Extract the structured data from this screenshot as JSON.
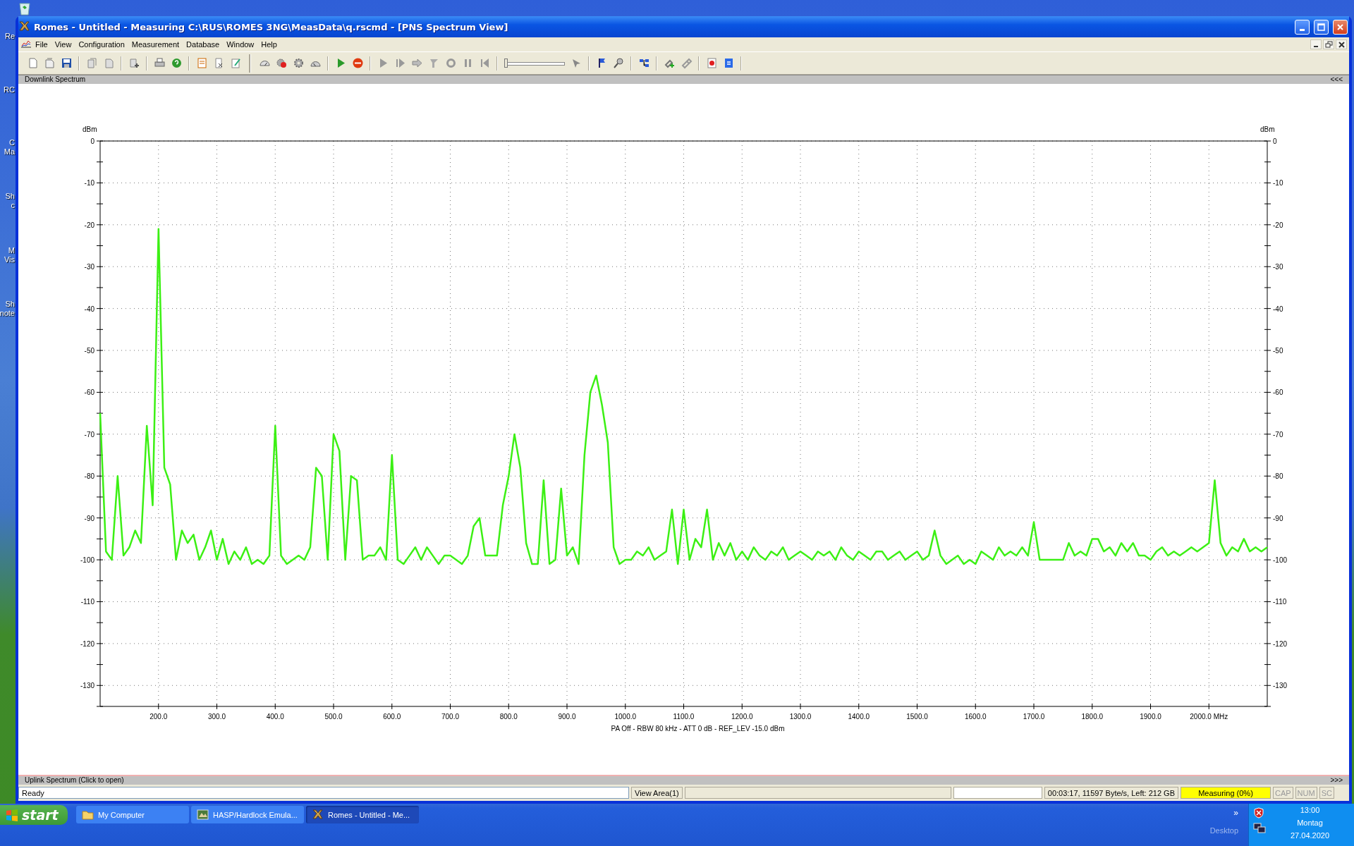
{
  "desktop": {
    "icons": [
      {
        "lines": [
          "Re"
        ]
      },
      {
        "lines": [
          "RC"
        ]
      },
      {
        "lines": [
          "C",
          "Ma"
        ]
      },
      {
        "lines": [
          "Sh",
          "c"
        ]
      },
      {
        "lines": [
          "M",
          "Vis"
        ]
      },
      {
        "lines": [
          "Sh",
          "note"
        ]
      }
    ]
  },
  "window": {
    "title": "Romes - Untitled - Measuring C:\\RUS\\ROMES 3NG\\MeasData\\q.rscmd - [PNS Spectrum View]"
  },
  "menu": [
    "File",
    "View",
    "Configuration",
    "Measurement",
    "Database",
    "Window",
    "Help"
  ],
  "toolbar": {
    "slider": {
      "level": 0
    }
  },
  "downlink": {
    "title": "Downlink Spectrum",
    "toggle": "<<<"
  },
  "chart": {
    "left_unit": "dBm",
    "right_unit": "dBm",
    "right_axis_labels": [
      "0",
      "-10",
      "-20",
      "-30",
      "-40",
      "-50",
      "-60",
      "-70",
      "-80",
      "-90",
      "-100",
      "-110",
      "-120",
      "-130"
    ],
    "caption": "PA Off - RBW 80 kHz - ATT 0 dB - REF_LEV -15.0 dBm",
    "chart_data": {
      "type": "line",
      "grid": true,
      "xlim": [
        100,
        2100
      ],
      "ylim": [
        -135,
        0
      ],
      "yticks": [
        0,
        -10,
        -20,
        -30,
        -40,
        -50,
        -60,
        -70,
        -80,
        -90,
        -100,
        -110,
        -120,
        -130
      ],
      "xticks": [
        {
          "value": 200,
          "label": "200.0"
        },
        {
          "value": 300,
          "label": "300.0"
        },
        {
          "value": 400,
          "label": "400.0"
        },
        {
          "value": 500,
          "label": "500.0"
        },
        {
          "value": 600,
          "label": "600.0"
        },
        {
          "value": 700,
          "label": "700.0"
        },
        {
          "value": 800,
          "label": "800.0"
        },
        {
          "value": 900,
          "label": "900.0"
        },
        {
          "value": 1000,
          "label": "1000.0"
        },
        {
          "value": 1100,
          "label": "1100.0"
        },
        {
          "value": 1200,
          "label": "1200.0"
        },
        {
          "value": 1300,
          "label": "1300.0"
        },
        {
          "value": 1400,
          "label": "1400.0"
        },
        {
          "value": 1500,
          "label": "1500.0"
        },
        {
          "value": 1600,
          "label": "1600.0"
        },
        {
          "value": 1700,
          "label": "1700.0"
        },
        {
          "value": 1800,
          "label": "1800.0"
        },
        {
          "value": 1900,
          "label": "1900.0"
        },
        {
          "value": 2000,
          "label": "2000.0 MHz"
        }
      ],
      "x": [
        100,
        110,
        120,
        130,
        140,
        150,
        160,
        170,
        180,
        190,
        200,
        210,
        220,
        230,
        240,
        250,
        260,
        270,
        280,
        290,
        300,
        310,
        320,
        330,
        340,
        350,
        360,
        370,
        380,
        390,
        400,
        410,
        420,
        430,
        440,
        450,
        460,
        470,
        480,
        490,
        500,
        510,
        520,
        530,
        540,
        550,
        560,
        570,
        580,
        590,
        600,
        610,
        620,
        630,
        640,
        650,
        660,
        670,
        680,
        690,
        700,
        710,
        720,
        730,
        740,
        750,
        760,
        770,
        780,
        790,
        800,
        810,
        820,
        830,
        840,
        850,
        860,
        870,
        880,
        890,
        900,
        910,
        920,
        930,
        940,
        950,
        960,
        970,
        980,
        990,
        1000,
        1010,
        1020,
        1030,
        1040,
        1050,
        1060,
        1070,
        1080,
        1090,
        1100,
        1110,
        1120,
        1130,
        1140,
        1150,
        1160,
        1170,
        1180,
        1190,
        1200,
        1210,
        1220,
        1230,
        1240,
        1250,
        1260,
        1270,
        1280,
        1290,
        1300,
        1310,
        1320,
        1330,
        1340,
        1350,
        1360,
        1370,
        1380,
        1390,
        1400,
        1410,
        1420,
        1430,
        1440,
        1450,
        1460,
        1470,
        1480,
        1490,
        1500,
        1510,
        1520,
        1530,
        1540,
        1550,
        1560,
        1570,
        1580,
        1590,
        1600,
        1610,
        1620,
        1630,
        1640,
        1650,
        1660,
        1670,
        1680,
        1690,
        1700,
        1710,
        1720,
        1730,
        1740,
        1750,
        1760,
        1770,
        1780,
        1790,
        1800,
        1810,
        1820,
        1830,
        1840,
        1850,
        1860,
        1870,
        1880,
        1890,
        1900,
        1910,
        1920,
        1930,
        1940,
        1950,
        1960,
        1970,
        1980,
        1990,
        2000,
        2010,
        2020,
        2030,
        2040,
        2050,
        2060,
        2070,
        2080,
        2090,
        2100
      ],
      "series": [
        {
          "color": "#3cf014",
          "values": [
            -65,
            -98,
            -100,
            -80,
            -99,
            -97,
            -93,
            -96,
            -68,
            -87,
            -21,
            -78,
            -82,
            -100,
            -93,
            -96,
            -94,
            -100,
            -97,
            -93,
            -100,
            -95,
            -101,
            -98,
            -100,
            -97,
            -101,
            -100,
            -101,
            -99,
            -68,
            -99,
            -101,
            -100,
            -99,
            -100,
            -97,
            -78,
            -80,
            -100,
            -70,
            -74,
            -100,
            -80,
            -81,
            -100,
            -99,
            -99,
            -97,
            -100,
            -75,
            -100,
            -101,
            -99,
            -97,
            -100,
            -97,
            -99,
            -101,
            -99,
            -99,
            -100,
            -101,
            -99,
            -92,
            -90,
            -99,
            -99,
            -99,
            -87,
            -80,
            -70,
            -78,
            -96,
            -101,
            -101,
            -81,
            -101,
            -100,
            -83,
            -99,
            -97,
            -101,
            -75,
            -60,
            -56,
            -63,
            -72,
            -97,
            -101,
            -100,
            -100,
            -98,
            -99,
            -97,
            -100,
            -99,
            -98,
            -88,
            -101,
            -88,
            -100,
            -95,
            -97,
            -88,
            -100,
            -96,
            -99,
            -96,
            -100,
            -98,
            -100,
            -97,
            -99,
            -100,
            -98,
            -99,
            -97,
            -100,
            -99,
            -98,
            -99,
            -100,
            -98,
            -99,
            -98,
            -100,
            -97,
            -99,
            -100,
            -98,
            -99,
            -100,
            -98,
            -98,
            -100,
            -99,
            -98,
            -100,
            -99,
            -98,
            -100,
            -99,
            -93,
            -99,
            -101,
            -100,
            -99,
            -101,
            -100,
            -101,
            -98,
            -99,
            -100,
            -97,
            -99,
            -98,
            -99,
            -97,
            -99,
            -91,
            -100,
            -100,
            -100,
            -100,
            -100,
            -96,
            -99,
            -98,
            -99,
            -95,
            -95,
            -98,
            -97,
            -99,
            -96,
            -98,
            -96,
            -99,
            -99,
            -100,
            -98,
            -97,
            -99,
            -98,
            -99,
            -98,
            -97,
            -98,
            -97,
            -96,
            -81,
            -96,
            -99,
            -97,
            -98,
            -95,
            -98,
            -97,
            -98,
            -97
          ]
        }
      ]
    }
  },
  "uplink": {
    "title": "Uplink Spectrum (Click to open)",
    "toggle": ">>>"
  },
  "status_bar": [
    {
      "kind": "field",
      "text": "Ready"
    },
    {
      "kind": "panel",
      "text": "View Area(1)"
    },
    {
      "kind": "blank"
    },
    {
      "kind": "white"
    },
    {
      "kind": "panel",
      "text": "00:03:17, 11597 Byte/s, Left: 212 GB"
    },
    {
      "kind": "highlight",
      "text": "Measuring (0%)"
    },
    {
      "kind": "indicator",
      "text": "CAP"
    },
    {
      "kind": "indicator",
      "text": "NUM"
    },
    {
      "kind": "indicator",
      "text": "SC"
    }
  ],
  "taskbar": {
    "start": "start",
    "buttons": [
      {
        "label": "My Computer",
        "selected": false
      },
      {
        "label": "HASP/Hardlock Emula...",
        "selected": false
      },
      {
        "label": "Romes - Untitled - Me...",
        "selected": true
      }
    ],
    "chevron": "»",
    "toolbar_label": "Desktop",
    "clock": [
      "13:00",
      "Montag",
      "27.04.2020"
    ]
  }
}
